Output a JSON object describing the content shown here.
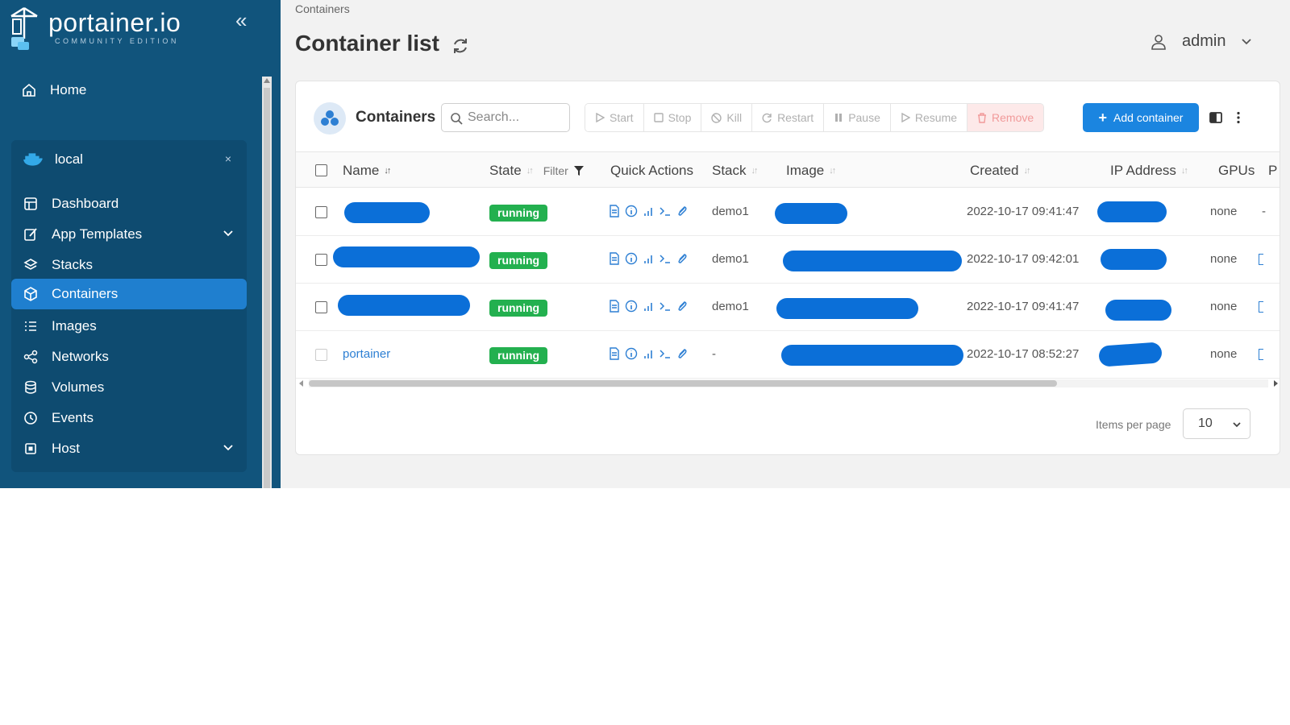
{
  "app": {
    "logo_text": "portainer.io",
    "logo_subtitle": "COMMUNITY EDITION"
  },
  "sidebar": {
    "home_label": "Home",
    "environment": {
      "name": "local",
      "close_label": "×",
      "items": [
        {
          "label": "Dashboard",
          "icon": "dashboard-icon"
        },
        {
          "label": "App Templates",
          "icon": "edit-icon",
          "expandable": true
        },
        {
          "label": "Stacks",
          "icon": "layers-icon"
        },
        {
          "label": "Containers",
          "icon": "box-icon",
          "active": true
        },
        {
          "label": "Images",
          "icon": "list-icon"
        },
        {
          "label": "Networks",
          "icon": "share-icon"
        },
        {
          "label": "Volumes",
          "icon": "database-icon"
        },
        {
          "label": "Events",
          "icon": "clock-icon"
        },
        {
          "label": "Host",
          "icon": "cpu-icon",
          "expandable": true
        }
      ]
    }
  },
  "header": {
    "breadcrumb": "Containers",
    "title": "Container list",
    "user": "admin"
  },
  "widget": {
    "title": "Containers",
    "search_placeholder": "Search...",
    "actions": [
      "Start",
      "Stop",
      "Kill",
      "Restart",
      "Pause",
      "Resume",
      "Remove"
    ],
    "add_button": "Add container"
  },
  "table": {
    "columns": {
      "name": "Name",
      "state": "State",
      "filter": "Filter",
      "quick_actions": "Quick Actions",
      "stack": "Stack",
      "image": "Image",
      "created": "Created",
      "ip": "IP Address",
      "gpus": "GPUs",
      "ports": "P"
    },
    "rows": [
      {
        "name": "",
        "state": "running",
        "stack": "demo1",
        "created": "2022-10-17 09:41:47",
        "gpus": "none",
        "trail": "-"
      },
      {
        "name": "",
        "state": "running",
        "stack": "demo1",
        "created": "2022-10-17 09:42:01",
        "gpus": "none",
        "trail": ""
      },
      {
        "name": "",
        "state": "running",
        "stack": "demo1",
        "created": "2022-10-17 09:41:47",
        "gpus": "none",
        "trail": ""
      },
      {
        "name": "portainer",
        "state": "running",
        "stack": "-",
        "created": "2022-10-17 08:52:27",
        "gpus": "none",
        "trail": ""
      }
    ]
  },
  "pagination": {
    "items_per_page_label": "Items per page",
    "items_per_page_value": "10"
  },
  "colors": {
    "sidebar": "#11547c",
    "accent": "#1b85e0",
    "running": "#23b04f",
    "redaction": "#0b6fd8"
  }
}
